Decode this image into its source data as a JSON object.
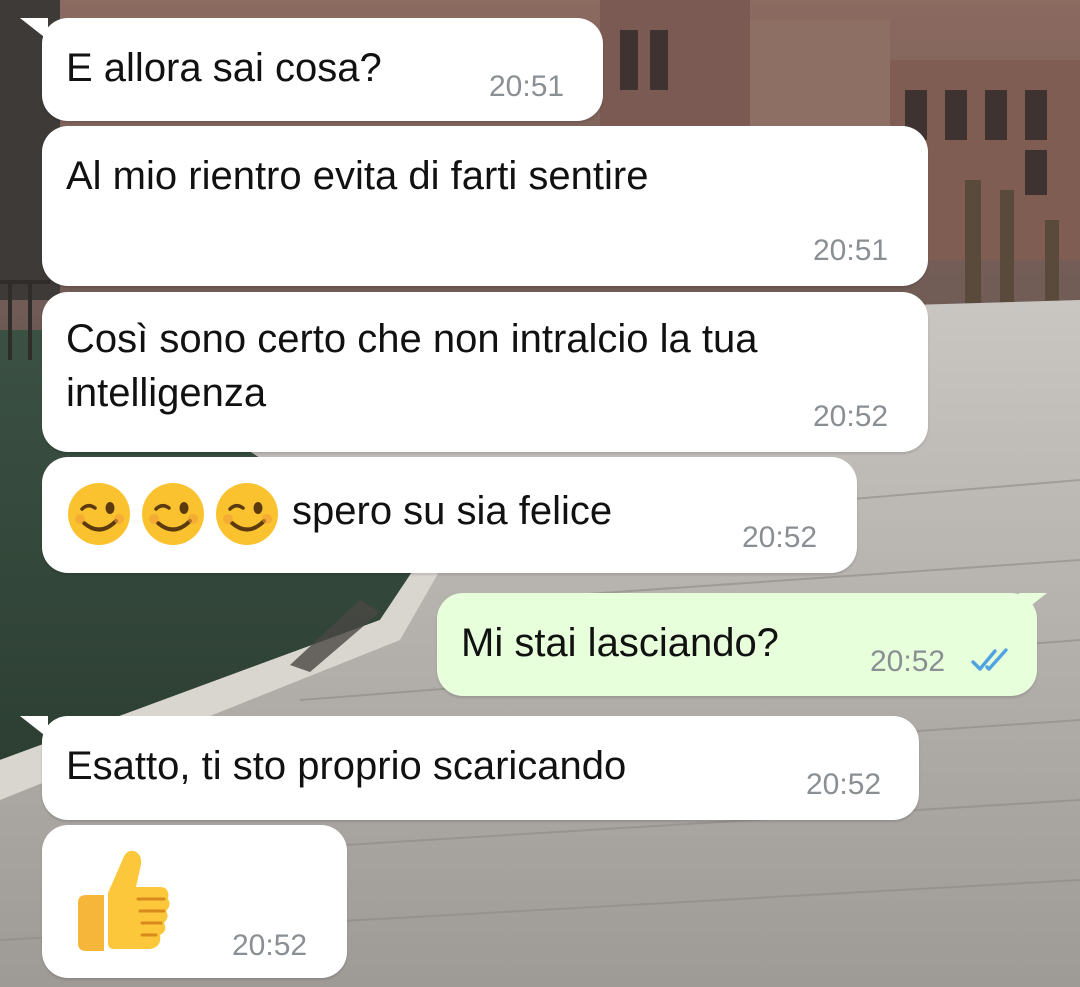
{
  "messages": [
    {
      "direction": "in",
      "text": "E allora sai cosa?",
      "time": "20:51"
    },
    {
      "direction": "in",
      "text": "Al mio rientro evita di farti sentire",
      "time": "20:51"
    },
    {
      "direction": "in",
      "text": "Così sono certo che non intralcio la tua\nintelligenza",
      "time": "20:52"
    },
    {
      "direction": "in",
      "emoji": [
        "winking-face",
        "winking-face",
        "winking-face"
      ],
      "text": "spero su sia felice",
      "time": "20:52"
    },
    {
      "direction": "out",
      "text": "Mi stai lasciando?",
      "time": "20:52",
      "status": "read"
    },
    {
      "direction": "in",
      "text": "Esatto, ti sto proprio scaricando",
      "time": "20:52"
    },
    {
      "direction": "in",
      "emoji": [
        "thumbs-up"
      ],
      "text": "",
      "time": "20:52"
    }
  ],
  "colors": {
    "incoming_bubble": "#ffffff",
    "outgoing_bubble": "#e7ffdb",
    "timestamp": "#8a8f93",
    "read_ticks": "#4fa3e0"
  }
}
